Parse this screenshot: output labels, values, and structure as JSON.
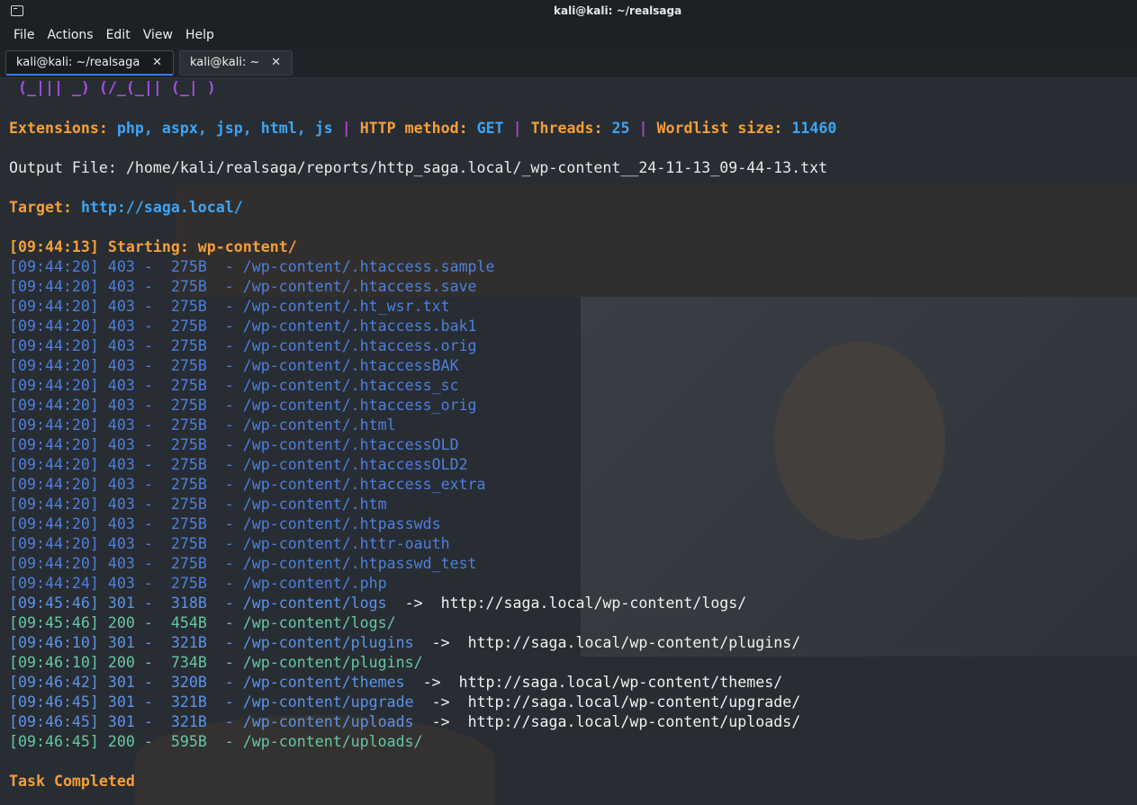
{
  "window": {
    "title": "kali@kali: ~/realsaga"
  },
  "menu": [
    "File",
    "Actions",
    "Edit",
    "View",
    "Help"
  ],
  "tabs": [
    {
      "label": "kali@kali: ~/realsaga",
      "close": "✕"
    },
    {
      "label": "kali@kali: ~",
      "close": "✕"
    }
  ],
  "terminal": {
    "ascii_art": "(_||| _) (/_(_|| (_| )",
    "ext_label": "Extensions:",
    "ext_value": "php, aspx, jsp, html, js",
    "separator": "|",
    "method_label": "HTTP method:",
    "method_value": "GET",
    "threads_label": "Threads:",
    "threads_value": "25",
    "wordlist_label": "Wordlist size:",
    "wordlist_value": "11460",
    "output_file": "Output File: /home/kali/realsaga/reports/http_saga.local/_wp-content__24-11-13_09-44-13.txt",
    "target_label": "Target:",
    "target_value": "http://saga.local/",
    "start_line": "[09:44:13] Starting: wp-content/",
    "results": [
      {
        "time": "[09:44:20]",
        "code": "403",
        "size": "275B",
        "path": "/wp-content/.htaccess.sample",
        "redirect": ""
      },
      {
        "time": "[09:44:20]",
        "code": "403",
        "size": "275B",
        "path": "/wp-content/.htaccess.save",
        "redirect": ""
      },
      {
        "time": "[09:44:20]",
        "code": "403",
        "size": "275B",
        "path": "/wp-content/.ht_wsr.txt",
        "redirect": ""
      },
      {
        "time": "[09:44:20]",
        "code": "403",
        "size": "275B",
        "path": "/wp-content/.htaccess.bak1",
        "redirect": ""
      },
      {
        "time": "[09:44:20]",
        "code": "403",
        "size": "275B",
        "path": "/wp-content/.htaccess.orig",
        "redirect": ""
      },
      {
        "time": "[09:44:20]",
        "code": "403",
        "size": "275B",
        "path": "/wp-content/.htaccessBAK",
        "redirect": ""
      },
      {
        "time": "[09:44:20]",
        "code": "403",
        "size": "275B",
        "path": "/wp-content/.htaccess_sc",
        "redirect": ""
      },
      {
        "time": "[09:44:20]",
        "code": "403",
        "size": "275B",
        "path": "/wp-content/.htaccess_orig",
        "redirect": ""
      },
      {
        "time": "[09:44:20]",
        "code": "403",
        "size": "275B",
        "path": "/wp-content/.html",
        "redirect": ""
      },
      {
        "time": "[09:44:20]",
        "code": "403",
        "size": "275B",
        "path": "/wp-content/.htaccessOLD",
        "redirect": ""
      },
      {
        "time": "[09:44:20]",
        "code": "403",
        "size": "275B",
        "path": "/wp-content/.htaccessOLD2",
        "redirect": ""
      },
      {
        "time": "[09:44:20]",
        "code": "403",
        "size": "275B",
        "path": "/wp-content/.htaccess_extra",
        "redirect": ""
      },
      {
        "time": "[09:44:20]",
        "code": "403",
        "size": "275B",
        "path": "/wp-content/.htm",
        "redirect": ""
      },
      {
        "time": "[09:44:20]",
        "code": "403",
        "size": "275B",
        "path": "/wp-content/.htpasswds",
        "redirect": ""
      },
      {
        "time": "[09:44:20]",
        "code": "403",
        "size": "275B",
        "path": "/wp-content/.httr-oauth",
        "redirect": ""
      },
      {
        "time": "[09:44:20]",
        "code": "403",
        "size": "275B",
        "path": "/wp-content/.htpasswd_test",
        "redirect": ""
      },
      {
        "time": "[09:44:24]",
        "code": "403",
        "size": "275B",
        "path": "/wp-content/.php",
        "redirect": ""
      },
      {
        "time": "[09:45:46]",
        "code": "301",
        "size": "318B",
        "path": "/wp-content/logs",
        "redirect": "http://saga.local/wp-content/logs/"
      },
      {
        "time": "[09:45:46]",
        "code": "200",
        "size": "454B",
        "path": "/wp-content/logs/",
        "redirect": ""
      },
      {
        "time": "[09:46:10]",
        "code": "301",
        "size": "321B",
        "path": "/wp-content/plugins",
        "redirect": "http://saga.local/wp-content/plugins/"
      },
      {
        "time": "[09:46:10]",
        "code": "200",
        "size": "734B",
        "path": "/wp-content/plugins/",
        "redirect": ""
      },
      {
        "time": "[09:46:42]",
        "code": "301",
        "size": "320B",
        "path": "/wp-content/themes",
        "redirect": "http://saga.local/wp-content/themes/"
      },
      {
        "time": "[09:46:45]",
        "code": "301",
        "size": "321B",
        "path": "/wp-content/upgrade",
        "redirect": "http://saga.local/wp-content/upgrade/"
      },
      {
        "time": "[09:46:45]",
        "code": "301",
        "size": "321B",
        "path": "/wp-content/uploads",
        "redirect": "http://saga.local/wp-content/uploads/"
      },
      {
        "time": "[09:46:45]",
        "code": "200",
        "size": "595B",
        "path": "/wp-content/uploads/",
        "redirect": ""
      }
    ],
    "arrow": "->",
    "task_completed": "Task Completed"
  }
}
